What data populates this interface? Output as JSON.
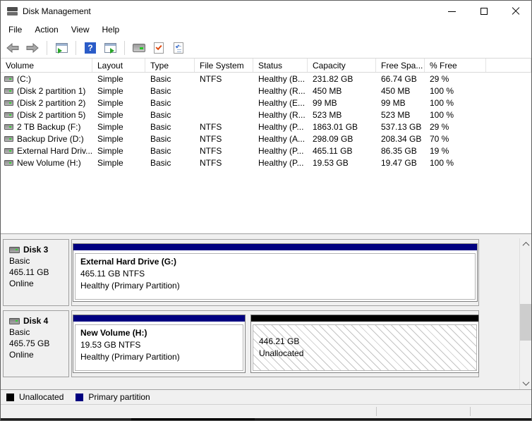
{
  "window": {
    "title": "Disk Management",
    "controls": [
      "minimize",
      "maximize",
      "close"
    ]
  },
  "menu": {
    "items": [
      "File",
      "Action",
      "View",
      "Help"
    ]
  },
  "toolbar": {
    "icons": [
      "back-icon",
      "forward-icon",
      "show-console-tree-icon",
      "help-icon",
      "show-action-pane-icon",
      "rescan-disks-icon",
      "check-document-icon",
      "properties-checklist-icon"
    ]
  },
  "table": {
    "columns": [
      "Volume",
      "Layout",
      "Type",
      "File System",
      "Status",
      "Capacity",
      "Free Spa...",
      "% Free"
    ],
    "rows": [
      {
        "volume": "(C:)",
        "layout": "Simple",
        "type": "Basic",
        "fs": "NTFS",
        "status": "Healthy (B...",
        "capacity": "231.82 GB",
        "free": "66.74 GB",
        "pct": "29 %"
      },
      {
        "volume": "(Disk 2 partition 1)",
        "layout": "Simple",
        "type": "Basic",
        "fs": "",
        "status": "Healthy (R...",
        "capacity": "450 MB",
        "free": "450 MB",
        "pct": "100 %"
      },
      {
        "volume": "(Disk 2 partition 2)",
        "layout": "Simple",
        "type": "Basic",
        "fs": "",
        "status": "Healthy (E...",
        "capacity": "99 MB",
        "free": "99 MB",
        "pct": "100 %"
      },
      {
        "volume": "(Disk 2 partition 5)",
        "layout": "Simple",
        "type": "Basic",
        "fs": "",
        "status": "Healthy (R...",
        "capacity": "523 MB",
        "free": "523 MB",
        "pct": "100 %"
      },
      {
        "volume": "2 TB Backup (F:)",
        "layout": "Simple",
        "type": "Basic",
        "fs": "NTFS",
        "status": "Healthy (P...",
        "capacity": "1863.01 GB",
        "free": "537.13 GB",
        "pct": "29 %"
      },
      {
        "volume": "Backup Drive (D:)",
        "layout": "Simple",
        "type": "Basic",
        "fs": "NTFS",
        "status": "Healthy (A...",
        "capacity": "298.09 GB",
        "free": "208.34 GB",
        "pct": "70 %"
      },
      {
        "volume": "External Hard Driv...",
        "layout": "Simple",
        "type": "Basic",
        "fs": "NTFS",
        "status": "Healthy (P...",
        "capacity": "465.11 GB",
        "free": "86.35 GB",
        "pct": "19 %"
      },
      {
        "volume": "New Volume (H:)",
        "layout": "Simple",
        "type": "Basic",
        "fs": "NTFS",
        "status": "Healthy (P...",
        "capacity": "19.53 GB",
        "free": "19.47 GB",
        "pct": "100 %"
      }
    ]
  },
  "disks": [
    {
      "name": "Disk 3",
      "type": "Basic",
      "size": "465.11 GB",
      "status": "Online",
      "partitions": [
        {
          "label": "External Hard Drive  (G:)",
          "info": "465.11 GB NTFS",
          "health": "Healthy (Primary Partition)",
          "kind": "primary"
        }
      ]
    },
    {
      "name": "Disk 4",
      "type": "Basic",
      "size": "465.75 GB",
      "status": "Online",
      "partitions": [
        {
          "label": "New Volume  (H:)",
          "info": "19.53 GB NTFS",
          "health": "Healthy (Primary Partition)",
          "kind": "primary"
        },
        {
          "size": "446.21 GB",
          "state": "Unallocated",
          "kind": "unallocated"
        }
      ]
    }
  ],
  "legend": {
    "items": [
      {
        "label": "Unallocated",
        "color": "#000000"
      },
      {
        "label": "Primary partition",
        "color": "#000080"
      }
    ]
  },
  "colors": {
    "primary_partition": "#000080",
    "unallocated": "#000000",
    "window_bg": "#f0f0f0"
  }
}
